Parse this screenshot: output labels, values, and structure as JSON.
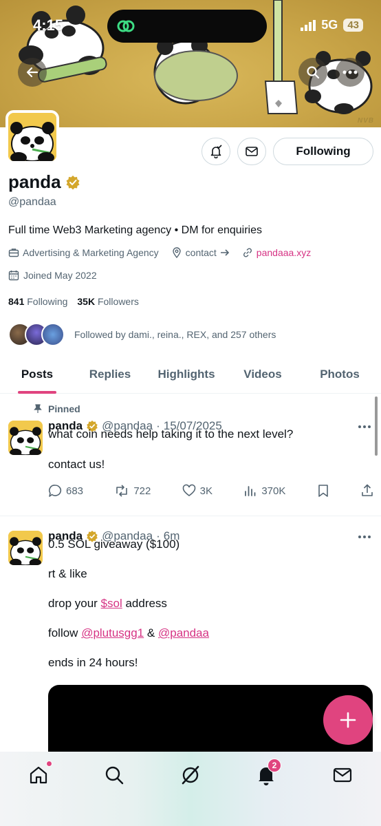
{
  "status_bar": {
    "time": "4:15",
    "network": "5G",
    "battery": "43"
  },
  "banner": {
    "signature": "NVB"
  },
  "profile": {
    "display_name": "panda",
    "handle": "@pandaa",
    "bio": "Full time Web3 Marketing agency • DM for enquiries",
    "category": "Advertising & Marketing Agency",
    "contact": "contact",
    "website": "pandaaa.xyz",
    "joined": "Joined May 2022",
    "following_count": "841",
    "following_label": "Following",
    "followers_count": "35K",
    "followers_label": "Followers",
    "followed_by": "Followed by dami., reina., REX, and 257 others",
    "follow_button": "Following"
  },
  "tabs": [
    {
      "label": "Posts"
    },
    {
      "label": "Replies"
    },
    {
      "label": "Highlights"
    },
    {
      "label": "Videos"
    },
    {
      "label": "Photos"
    }
  ],
  "posts": [
    {
      "pinned_label": "Pinned",
      "name": "panda",
      "handle": "@pandaa",
      "time": "15/07/2025",
      "text_lines": [
        "what coin needs help taking it to the next level?",
        "",
        "contact us!"
      ],
      "replies": "683",
      "reposts": "722",
      "likes": "3K",
      "views": "370K"
    },
    {
      "name": "panda",
      "handle": "@pandaa",
      "time": "6m",
      "line1": "0.5 SOL giveaway ($100)",
      "line2": "rt & like",
      "line3_pre": "drop your ",
      "line3_link": "$sol",
      "line3_post": " address",
      "line4_pre": "follow ",
      "line4_link1": "@plutusgg1",
      "line4_mid": " & ",
      "line4_link2": "@pandaa",
      "line5": "ends in 24 hours!"
    }
  ],
  "nav": {
    "notifications_badge": "2"
  },
  "colors": {
    "accent": "#e0447f",
    "verified": "#d4a72c",
    "banner": "#c9a548"
  }
}
